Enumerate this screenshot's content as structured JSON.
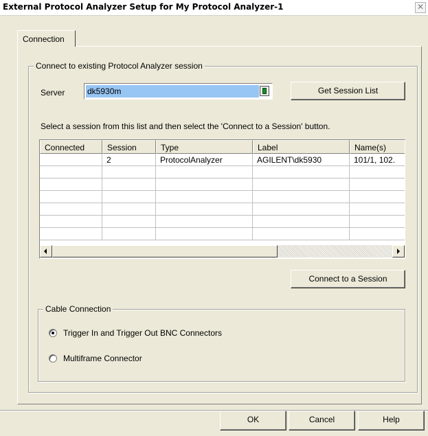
{
  "window": {
    "title": "External Protocol Analyzer Setup for My Protocol Analyzer-1",
    "close_glyph": "✕"
  },
  "tabs": [
    {
      "label": "Connection",
      "selected": true
    }
  ],
  "session_group": {
    "legend": "Connect to existing Protocol Analyzer session",
    "server_label": "Server",
    "server_value": "dk5930m",
    "server_picker_icon": "server-browse-icon",
    "get_session_list_label": "Get Session List",
    "instructions": "Select a session from this list and then select the  'Connect to a Session'  button.",
    "columns": [
      "Connected",
      "Session",
      "Type",
      "Label",
      "Name(s)"
    ],
    "rows": [
      [
        "",
        "2",
        "ProtocolAnalyzer",
        "AGILENT\\dk5930",
        "101/1, 102."
      ]
    ],
    "connect_label": "Connect to a Session"
  },
  "cable_group": {
    "legend": "Cable Connection",
    "options": [
      {
        "label": "Trigger In and Trigger Out BNC Connectors",
        "checked": true
      },
      {
        "label": "Multiframe Connector",
        "checked": false
      }
    ]
  },
  "footer": {
    "ok_label": "OK",
    "cancel_label": "Cancel",
    "help_label": "Help"
  },
  "colors": {
    "dialog_bg": "#ece9d8",
    "selection": "#97c5f4"
  }
}
